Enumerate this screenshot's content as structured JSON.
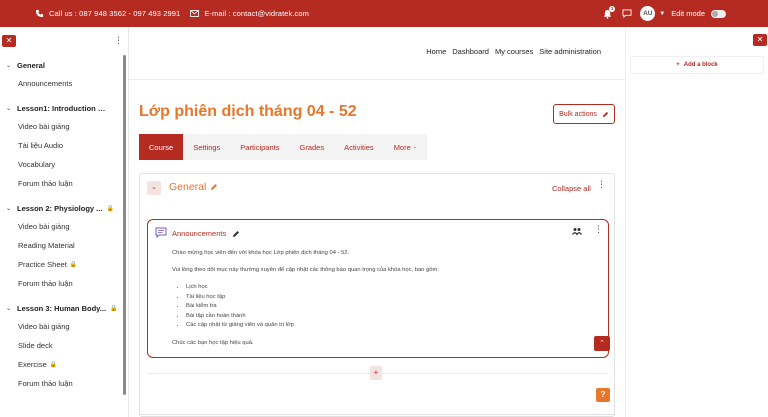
{
  "topbar": {
    "phone": "Call us : 087 948 3562 - 097 493 2991",
    "email": "E-mail : contact@vidratek.com",
    "notification_count": "1",
    "user_initials": "AU",
    "edit_mode_label": "Edit mode"
  },
  "nav": {
    "items": [
      "Home",
      "Dashboard",
      "My courses",
      "Site administration"
    ]
  },
  "drawer": {
    "close_label": "✕",
    "sections": [
      {
        "title": "General",
        "locked": false,
        "items": [
          {
            "label": "Announcements",
            "locked": false
          }
        ]
      },
      {
        "title": "Lesson1: Introduction to A...",
        "locked": false,
        "items": [
          {
            "label": "Video bài giảng",
            "locked": false
          },
          {
            "label": "Tài liệu Audio",
            "locked": false
          },
          {
            "label": "Vocabulary",
            "locked": false
          },
          {
            "label": "Forum thảo luận",
            "locked": false
          }
        ]
      },
      {
        "title": "Lesson 2: Physiology ...",
        "locked": true,
        "items": [
          {
            "label": "Video bài giảng",
            "locked": false
          },
          {
            "label": "Reading Material",
            "locked": false
          },
          {
            "label": "Practice Sheet",
            "locked": true
          },
          {
            "label": "Forum thảo luận",
            "locked": false
          }
        ]
      },
      {
        "title": "Lesson 3: Human Body...",
        "locked": true,
        "items": [
          {
            "label": "Video bài giảng",
            "locked": false
          },
          {
            "label": "Slide deck",
            "locked": false
          },
          {
            "label": "Exercise",
            "locked": true
          },
          {
            "label": "Forum thảo luận",
            "locked": false
          }
        ]
      }
    ]
  },
  "page": {
    "title": "Lớp phiên dịch tháng 04 - 52",
    "bulk_actions": "Bulk actions",
    "tabs": [
      "Course",
      "Settings",
      "Participants",
      "Grades",
      "Activities",
      "More"
    ],
    "active_tab": "Course"
  },
  "section": {
    "title": "General",
    "collapse_all": "Collapse all"
  },
  "activity": {
    "title": "Announcements",
    "intro": "Chào mừng học viên đến với khóa học Lớp phiên dịch tháng 04 - 52.",
    "instruction": "Vui lòng theo dõi mục này thường xuyên để cập nhật các thông báo quan trọng của khóa học, bao gồm:",
    "list": [
      "Lịch học",
      "Tài liệu học tập",
      "Bài kiểm tra",
      "Bài tập cần hoàn thành",
      "Các cập nhật từ giảng viên và quản trị lớp"
    ],
    "closing": "Chúc các bạn học tập hiệu quả."
  },
  "right_drawer": {
    "add_block": "Add a block"
  },
  "colors": {
    "brand": "#b52b22",
    "accent": "#e8762b"
  }
}
